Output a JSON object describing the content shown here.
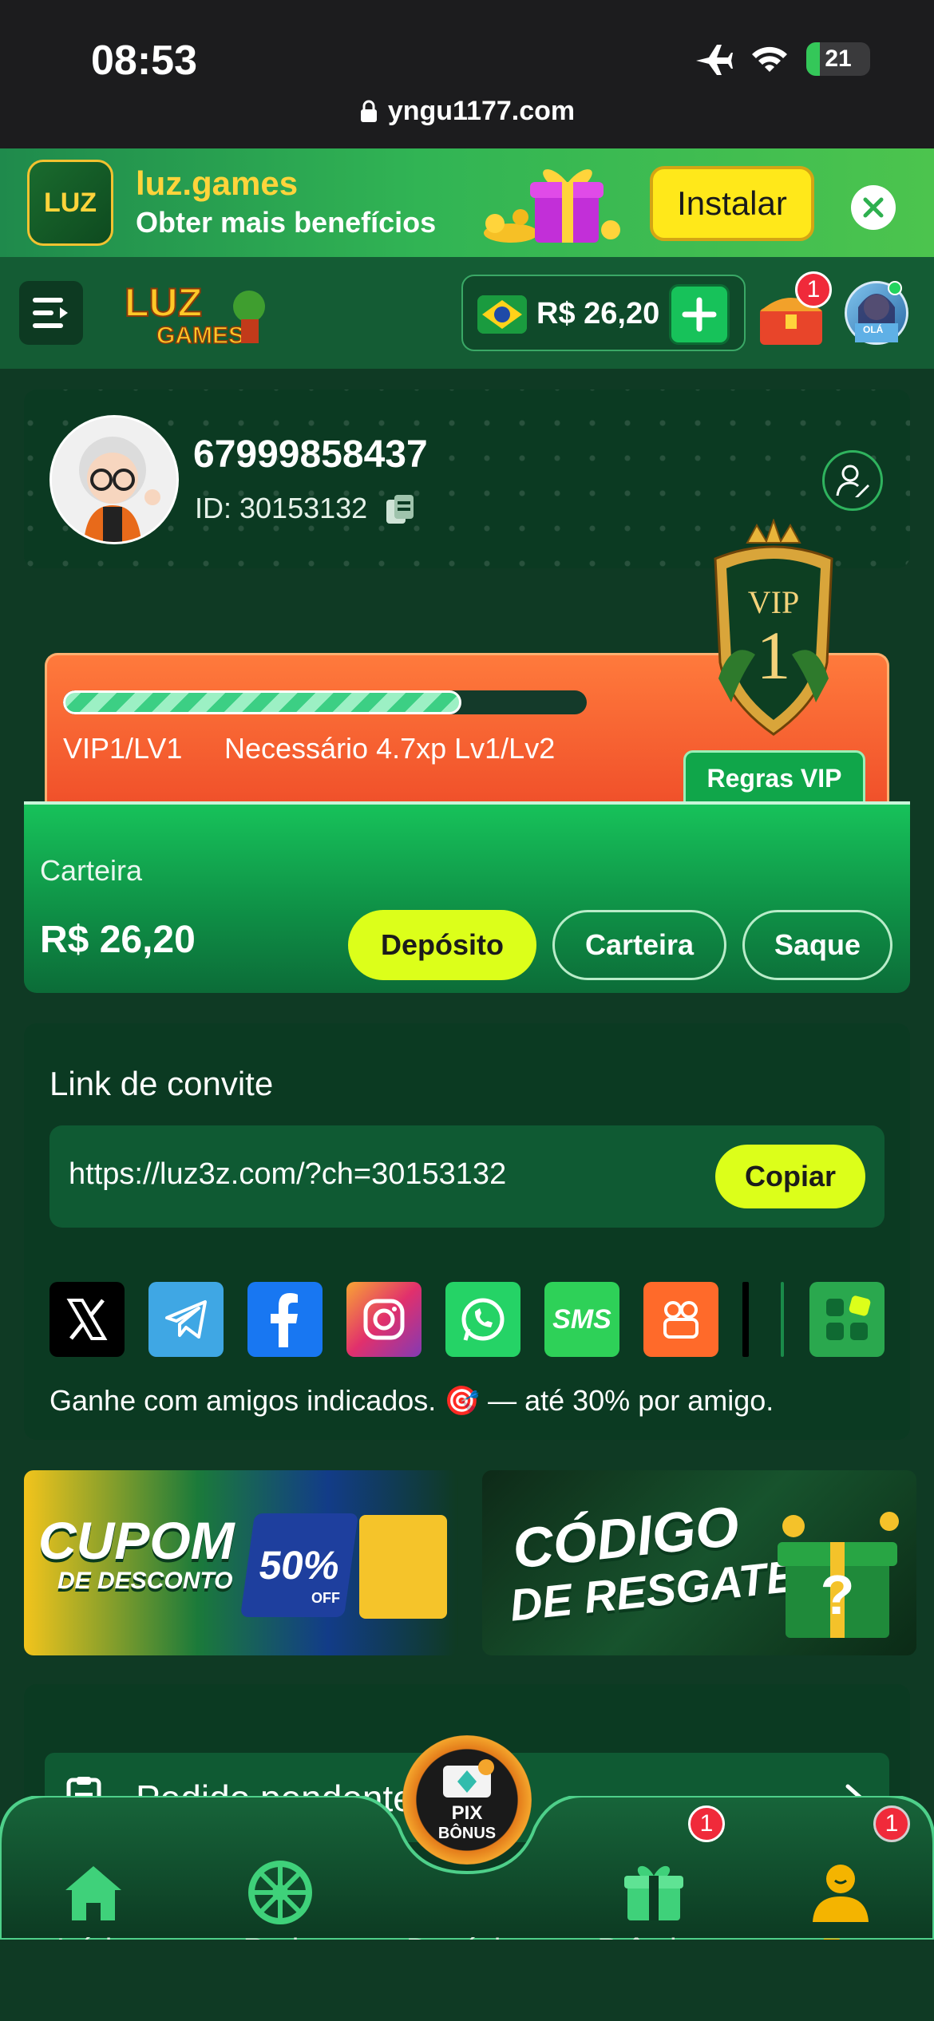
{
  "status_bar": {
    "time": "08:53",
    "battery": "21"
  },
  "browser": {
    "url": "yngu1177.com"
  },
  "install_banner": {
    "app_name": "luz.games",
    "subtitle": "Obter mais benefícios",
    "install_label": "Instalar"
  },
  "header": {
    "balance": "R$ 26,20",
    "notification_count": "1",
    "avatar_label": "OLÁ"
  },
  "profile": {
    "username": "67999858437",
    "id_text": "ID: 30153132"
  },
  "vip": {
    "level_text": "VIP1/LV1",
    "requirement_text": "Necessário 4.7xp Lv1/Lv2",
    "progress_fraction": 0.76,
    "rules_label": "Regras VIP",
    "badge_text": "VIP",
    "badge_number": "1"
  },
  "wallet": {
    "label": "Carteira",
    "amount": "R$ 26,20",
    "deposit_label": "Depósito",
    "wallet_label": "Carteira",
    "withdraw_label": "Saque"
  },
  "invite": {
    "title": "Link de convite",
    "link": "https://luz3z.com/?ch=30153132",
    "copy_label": "Copiar",
    "note": "Ganhe com amigos indicados. 🎯 — até 30% por amigo.",
    "socials": [
      "x-icon",
      "telegram-icon",
      "facebook-icon",
      "instagram-icon",
      "whatsapp-icon",
      "sms-icon",
      "kwai-icon",
      "more-apps-icon"
    ],
    "sms_text": "SMS"
  },
  "promos": {
    "left_title": "CUPOM",
    "left_sub": "DE DESCONTO",
    "left_discount": "50%",
    "left_off": "OFF",
    "right_title": "CÓDIGO",
    "right_sub": "DE RESGATE"
  },
  "pending": {
    "label": "Pedido pendente"
  },
  "bottom_nav": {
    "items": [
      {
        "label": "Início",
        "icon": "home-icon"
      },
      {
        "label": "Roda",
        "icon": "wheel-icon"
      },
      {
        "label": "Depósito",
        "icon": "pix-bonus-icon"
      },
      {
        "label": "Prêmios",
        "icon": "gift-icon",
        "badge": "1"
      },
      {
        "label": "Eu",
        "icon": "user-icon",
        "badge": "1"
      }
    ],
    "pix_text": "PIX",
    "pix_sub": "BÔNUS"
  },
  "colors": {
    "accent": "#dcff1a",
    "brand_green": "#17c25a",
    "active_tab": "#f4b400"
  }
}
